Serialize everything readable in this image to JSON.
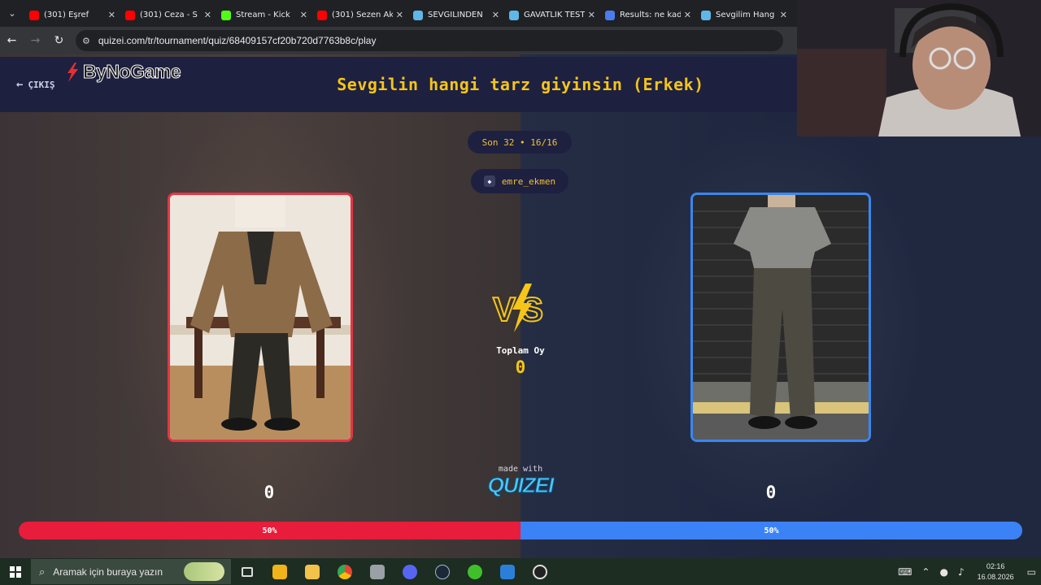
{
  "browser": {
    "tab_menu_icon": "chevron-down-icon",
    "tabs": [
      {
        "title": "(301) Eşref",
        "favicon": "youtube",
        "color": "#ff0000"
      },
      {
        "title": "(301) Ceza - S",
        "favicon": "youtube",
        "color": "#ff0000"
      },
      {
        "title": "Stream - Kick",
        "favicon": "kick",
        "color": "#53fc18"
      },
      {
        "title": "(301) Sezen Ak",
        "favicon": "youtube",
        "color": "#ff0000"
      },
      {
        "title": "SEVGİLİNDEN",
        "favicon": "quizei",
        "color": "#5fb7e8"
      },
      {
        "title": "GAVATLIK TEST",
        "favicon": "quizei",
        "color": "#5fb7e8"
      },
      {
        "title": "Results: ne kad",
        "favicon": "results",
        "color": "#4a7cf0"
      },
      {
        "title": "Sevgilim Hang",
        "favicon": "quizei",
        "color": "#5fb7e8"
      }
    ],
    "url": "quizei.com/tr/tournament/quiz/68409157cf20b720d7763b8c/play"
  },
  "header": {
    "back_label": "ÇIKIŞ",
    "brand": "ByNoGame",
    "title": "Sevgilin hangi tarz giyinsin (Erkek)"
  },
  "round": "Son 32 • 16/16",
  "username": "emre_ekmen",
  "total": {
    "label": "Toplam Oy",
    "value": "0"
  },
  "scores": {
    "left": "0",
    "right": "0"
  },
  "made_with": "made with",
  "logo": "QUIZEI",
  "progress": {
    "left_label": "50%",
    "right_label": "50%",
    "left_fraction": 0.5
  },
  "colors": {
    "accent_yellow": "#f5c518",
    "left_red": "#e81c3b",
    "right_blue": "#3b82f6",
    "header_navy": "#1e2040"
  },
  "taskbar": {
    "search_placeholder": "Aramak için buraya yazın",
    "time": "02:16",
    "date": "16.08.2026"
  }
}
